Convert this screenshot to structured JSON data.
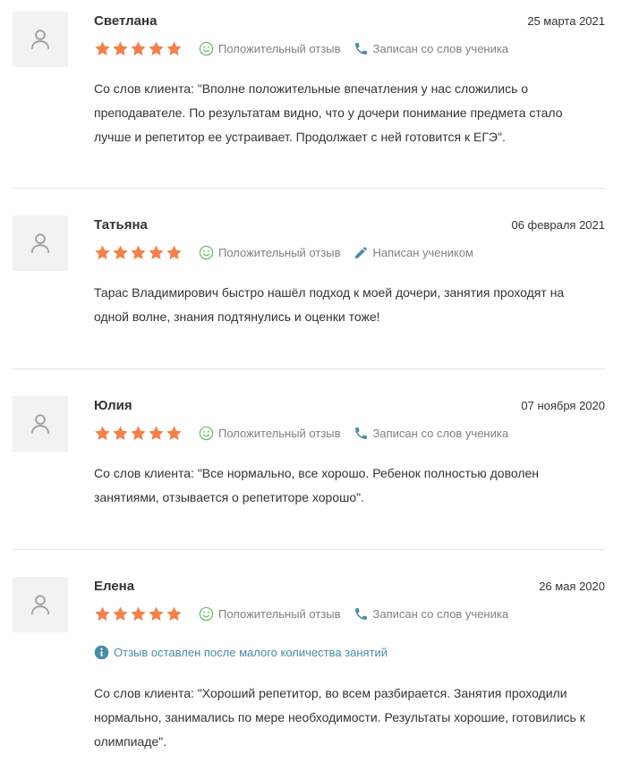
{
  "reviews": [
    {
      "name": "Светлана",
      "date": "25 марта 2021",
      "rating": 5,
      "sentiment": "Положительный отзыв",
      "source": "Записан со слов ученика",
      "source_icon": "phone-icon",
      "note": "",
      "text": "Со слов клиента: \"Вполне положительные впечатления у нас сложились о преподавателе. По результатам видно, что у дочери понимание предмета стало лучше и репетитор ее устраивает. Продолжает с ней готовится к ЕГЭ\"."
    },
    {
      "name": "Татьяна",
      "date": "06 февраля 2021",
      "rating": 5,
      "sentiment": "Положительный отзыв",
      "source": "Написан учеником",
      "source_icon": "pencil-icon",
      "note": "",
      "text": "Тарас Владимирович быстро нашёл подход к моей дочери, занятия проходят на одной волне, знания подтянулись и оценки тоже!"
    },
    {
      "name": "Юлия",
      "date": "07 ноября 2020",
      "rating": 5,
      "sentiment": "Положительный отзыв",
      "source": "Записан со слов ученика",
      "source_icon": "phone-icon",
      "note": "",
      "text": "Со слов клиента: \"Все нормально, все хорошо. Ребенок полностью доволен занятиями, отзывается о репетиторе хорошо\"."
    },
    {
      "name": "Елена",
      "date": "26 мая 2020",
      "rating": 5,
      "sentiment": "Положительный отзыв",
      "source": "Записан со слов ученика",
      "source_icon": "phone-icon",
      "note": "Отзыв оставлен после малого количества занятий",
      "text": "Со слов клиента: \"Хороший репетитор, во всем разбирается. Занятия проходили нормально, занимались по мере необходимости. Результаты хорошие, готовились к олимпиаде\"."
    }
  ],
  "colors": {
    "star": "#f2804a",
    "sentiment_icon": "#6cbf6c",
    "source_icon": "#4a8aa8",
    "note_icon": "#4a8aa8",
    "note_text": "#4a8aa8",
    "muted_text": "#808080",
    "avatar_bg": "#f2f2f2",
    "divider": "#e6e6e6"
  }
}
